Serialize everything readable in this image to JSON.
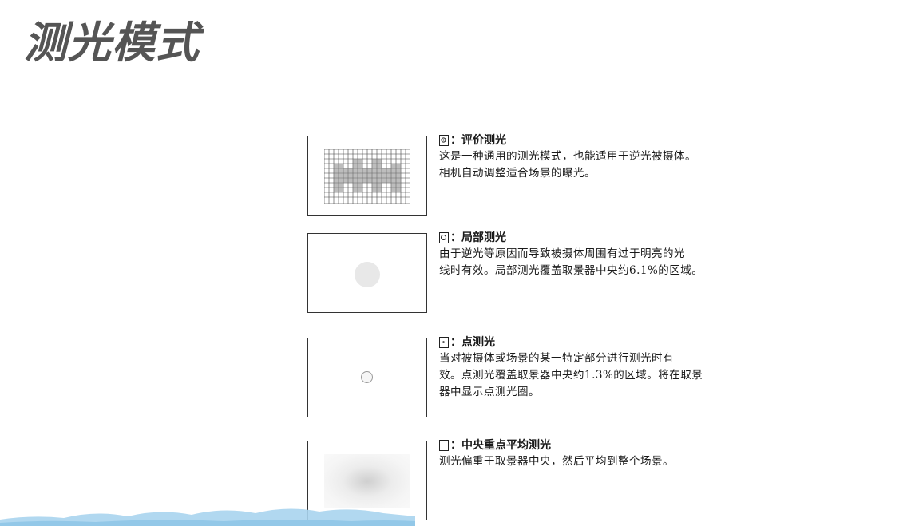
{
  "page": {
    "title": "测光模式"
  },
  "modes": [
    {
      "icon": "evaluative-metering-icon",
      "heading": "：评价测光",
      "desc_lines": [
        "这是一种通用的测光模式，也能适用于逆光被摄体。",
        "相机自动调整适合场景的曝光。"
      ]
    },
    {
      "icon": "partial-metering-icon",
      "heading": "：局部测光",
      "desc_lines": [
        "由于逆光等原因而导致被摄体周围有过于明亮的光",
        "线时有效。局部测光覆盖取景器中央约6.1%的区域。"
      ]
    },
    {
      "icon": "spot-metering-icon",
      "heading": "：点测光",
      "desc_lines": [
        "当对被摄体或场景的某一特定部分进行测光时有",
        "效。点测光覆盖取景器中央约1.3%的区域。将在取景",
        "器中显示点测光圈。"
      ]
    },
    {
      "icon": "center-weighted-metering-icon",
      "heading": "：中央重点平均测光",
      "desc_lines": [
        "测光偏重于取景器中央，然后平均到整个场景。"
      ]
    }
  ],
  "colors": {
    "title": "#555555",
    "wave": "#a9d4ee"
  }
}
